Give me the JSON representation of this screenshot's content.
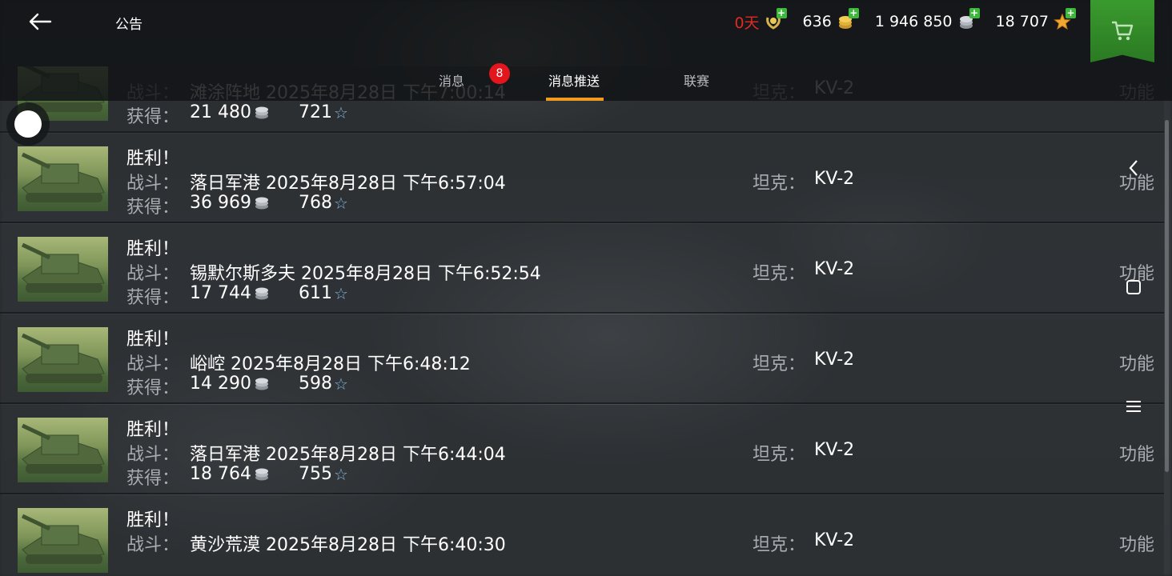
{
  "header": {
    "title": "公告",
    "back_icon": "arrow-left-icon",
    "currencies": [
      {
        "value": "0天",
        "icon": "premium-laurel-icon",
        "color": "#e02a22"
      },
      {
        "value": "636",
        "icon": "gold-coins-icon"
      },
      {
        "value": "1 946 850",
        "icon": "silver-coins-icon"
      },
      {
        "value": "18 707",
        "icon": "free-xp-star-icon"
      }
    ],
    "shop_icon": "shopping-cart-icon"
  },
  "tabs": [
    {
      "label": "消息",
      "badge": "8"
    },
    {
      "label": "消息推送",
      "active": true
    },
    {
      "label": "联赛"
    }
  ],
  "labels": {
    "battle": "战斗：",
    "earned": "获得：",
    "tank": "坦克：",
    "function": "功能"
  },
  "messages": [
    {
      "title": "",
      "battle": "滩涂阵地 2025年8月28日 下午7:00:14",
      "silver": "21 480",
      "xp": "721",
      "tank": "KV-2"
    },
    {
      "title": "胜利！",
      "battle": "落日军港 2025年8月28日 下午6:57:04",
      "silver": "36 969",
      "xp": "768",
      "tank": "KV-2"
    },
    {
      "title": "胜利！",
      "battle": "锡默尔斯多夫 2025年8月28日 下午6:52:54",
      "silver": "17 744",
      "xp": "611",
      "tank": "KV-2"
    },
    {
      "title": "胜利！",
      "battle": "峪崆 2025年8月28日 下午6:48:12",
      "silver": "14 290",
      "xp": "598",
      "tank": "KV-2"
    },
    {
      "title": "胜利！",
      "battle": "落日军港 2025年8月28日 下午6:44:04",
      "silver": "18 764",
      "xp": "755",
      "tank": "KV-2"
    },
    {
      "title": "胜利！",
      "battle": "黄沙荒漠 2025年8月28日 下午6:40:30",
      "silver": "",
      "xp": "",
      "tank": "KV-2"
    }
  ],
  "system_nav": [
    "chevron-left-icon",
    "square-icon",
    "menu-icon"
  ],
  "colors": {
    "accent_tab": "#f29a1d",
    "badge": "#e3161d",
    "shop_green": "#3a9a2e",
    "xp_star": "#7fb3d9"
  }
}
